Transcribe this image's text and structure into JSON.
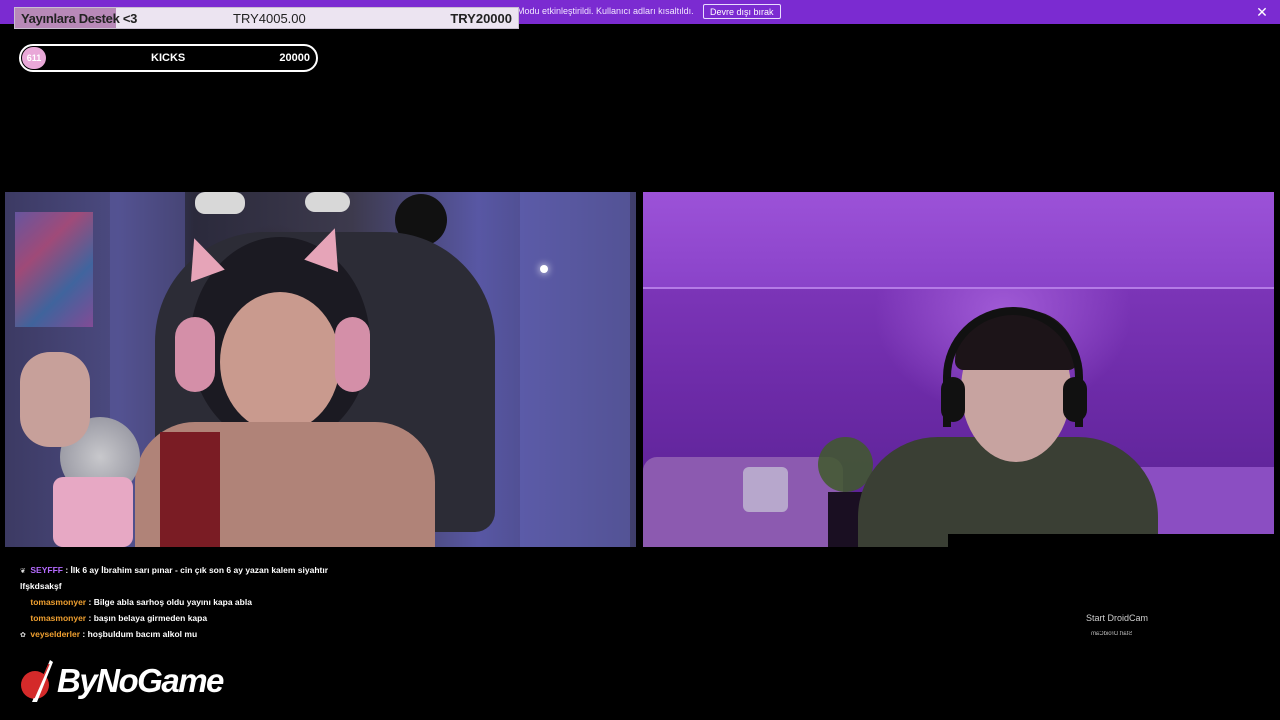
{
  "notification": {
    "message": "Modu etkinleştirildi. Kullanıcı adları kısaltıldı.",
    "disable_label": "Devre dışı bırak",
    "close_glyph": "✕"
  },
  "donation": {
    "title": "Yayınlara Destek",
    "title_suffix": "<3",
    "current": "TRY4005.00",
    "goal": "TRY20000",
    "progress": 0.2
  },
  "kicks": {
    "count": "611",
    "label": "KICKS",
    "goal": "20000"
  },
  "chat": {
    "messages": [
      {
        "user": "SEYFFF",
        "text": ": İlk 6 ay İbrahim sarı pınar - cin çık son 6 ay yazan kalem siyahtır lfşkdsakşf",
        "color": "#b56bff",
        "badge": "❦"
      },
      {
        "user": "tomasmonyer",
        "text": ": Bilge abla sarhoş oldu yayını kapa abla",
        "color": "#f0a030",
        "badge": ""
      },
      {
        "user": "tomasmonyer",
        "text": ": başın belaya girmeden kapa",
        "color": "#f0a030",
        "badge": ""
      },
      {
        "user": "veyselderler",
        "text": ": hoşbuldum bacım alkol mu",
        "color": "#f0a030",
        "badge": "✿"
      }
    ]
  },
  "logo": {
    "text": "ByNoGame",
    "icon": "bynogame-logo-icon"
  },
  "droidcam": {
    "label": "Start DroidCam",
    "mirrored_label": "Start DroidCam"
  },
  "colors": {
    "topbar": "#7b2bd1",
    "kicks_badge": "#e9a8d8",
    "donation_fill": "#b889b8"
  }
}
